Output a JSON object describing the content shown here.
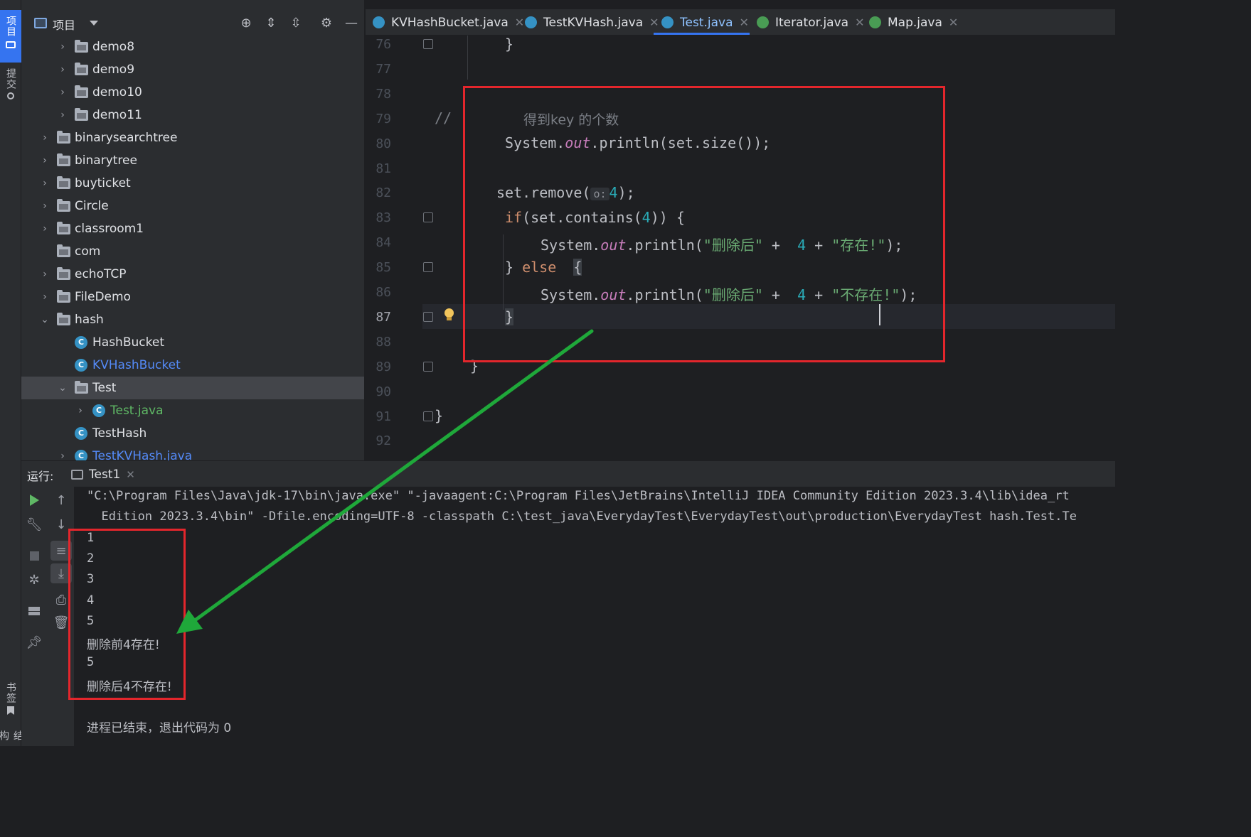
{
  "tool_strip": {
    "project_label": "项目",
    "commit_label": "提交",
    "bookmarks_label": "书签",
    "structure_label": "结构"
  },
  "project_panel": {
    "title": "项目",
    "tree": [
      {
        "label": "demo8",
        "type": "folder",
        "expanded": false
      },
      {
        "label": "demo9",
        "type": "folder",
        "expanded": false
      },
      {
        "label": "demo10",
        "type": "folder",
        "expanded": false
      },
      {
        "label": "demo11",
        "type": "folder",
        "expanded": false
      },
      {
        "label": "binarysearchtree",
        "type": "folder",
        "expanded": false
      },
      {
        "label": "binarytree",
        "type": "folder",
        "expanded": false
      },
      {
        "label": "buyticket",
        "type": "folder",
        "expanded": false
      },
      {
        "label": "Circle",
        "type": "folder",
        "expanded": false
      },
      {
        "label": "classroom1",
        "type": "folder",
        "expanded": false
      },
      {
        "label": "com",
        "type": "folder",
        "expanded": false
      },
      {
        "label": "echoTCP",
        "type": "folder",
        "expanded": false
      },
      {
        "label": "FileDemo",
        "type": "folder",
        "expanded": false
      },
      {
        "label": "hash",
        "type": "folder",
        "expanded": true
      },
      {
        "label": "HashBucket",
        "type": "class"
      },
      {
        "label": "KVHashBucket",
        "type": "class"
      },
      {
        "label": "Test",
        "type": "folder",
        "expanded": true,
        "selected": true
      },
      {
        "label": "Test.java",
        "type": "class"
      },
      {
        "label": "TestHash",
        "type": "class"
      },
      {
        "label": "TestKVHash.java",
        "type": "class"
      }
    ]
  },
  "tabs": [
    {
      "label": "KVHashBucket.java",
      "kind": "class"
    },
    {
      "label": "TestKVHash.java",
      "kind": "class"
    },
    {
      "label": "Test.java",
      "kind": "class",
      "active": true
    },
    {
      "label": "Iterator.java",
      "kind": "interface"
    },
    {
      "label": "Map.java",
      "kind": "interface"
    }
  ],
  "editor": {
    "line_numbers": [
      "76",
      "77",
      "78",
      "79",
      "80",
      "81",
      "82",
      "83",
      "84",
      "85",
      "86",
      "87",
      "88",
      "89",
      "90",
      "91",
      "92"
    ],
    "current_line": "87",
    "code": {
      "l76": "}",
      "l79_comment_prefix": "//",
      "l79_comment_text": "得到key 的个数",
      "l80_a": "System.",
      "l80_field": "out",
      "l80_b": ".println(set.size());",
      "l82_a": "set.remove(",
      "l82_hint": "o:",
      "l82_num": "4",
      "l82_b": ");",
      "l83_kw": "if",
      "l83_a": "(set.contains(",
      "l83_num": "4",
      "l83_b": ")) {",
      "l84_a": "System.",
      "l84_field": "out",
      "l84_b": ".println(",
      "l84_str1": "\"删除后\"",
      "l84_plus1": " +  ",
      "l84_num": "4",
      "l84_plus2": " + ",
      "l84_str2": "\"存在!\"",
      "l84_end": ");",
      "l85_a": "} ",
      "l85_kw": "else",
      "l85_b": "  ",
      "l85_brace": "{",
      "l86_a": "System.",
      "l86_field": "out",
      "l86_b": ".println(",
      "l86_str1": "\"删除后\"",
      "l86_plus1": " +  ",
      "l86_num": "4",
      "l86_plus2": " + ",
      "l86_str2": "\"不存在!\"",
      "l86_end": ");",
      "l87": "}",
      "l89": "}",
      "l91": "}"
    }
  },
  "run_panel": {
    "title": "运行:",
    "tab_label": "Test1",
    "console_lines": [
      "\"C:\\Program Files\\Java\\jdk-17\\bin\\java.exe\" \"-javaagent:C:\\Program Files\\JetBrains\\IntelliJ IDEA Community Edition 2023.3.4\\lib\\idea_rt",
      "  Edition 2023.3.4\\bin\" -Dfile.encoding=UTF-8 -classpath C:\\test_java\\EverydayTest\\EverydayTest\\out\\production\\EverydayTest hash.Test.Te",
      "1",
      "2",
      "3",
      "4",
      "5",
      "删除前4存在!",
      "5",
      "删除后4不存在!",
      "",
      "进程已结束，退出代码为 0"
    ]
  },
  "colors": {
    "annotation_box": "#e3262c",
    "annotation_arrow": "#1fa83a",
    "accent": "#3574f0"
  }
}
